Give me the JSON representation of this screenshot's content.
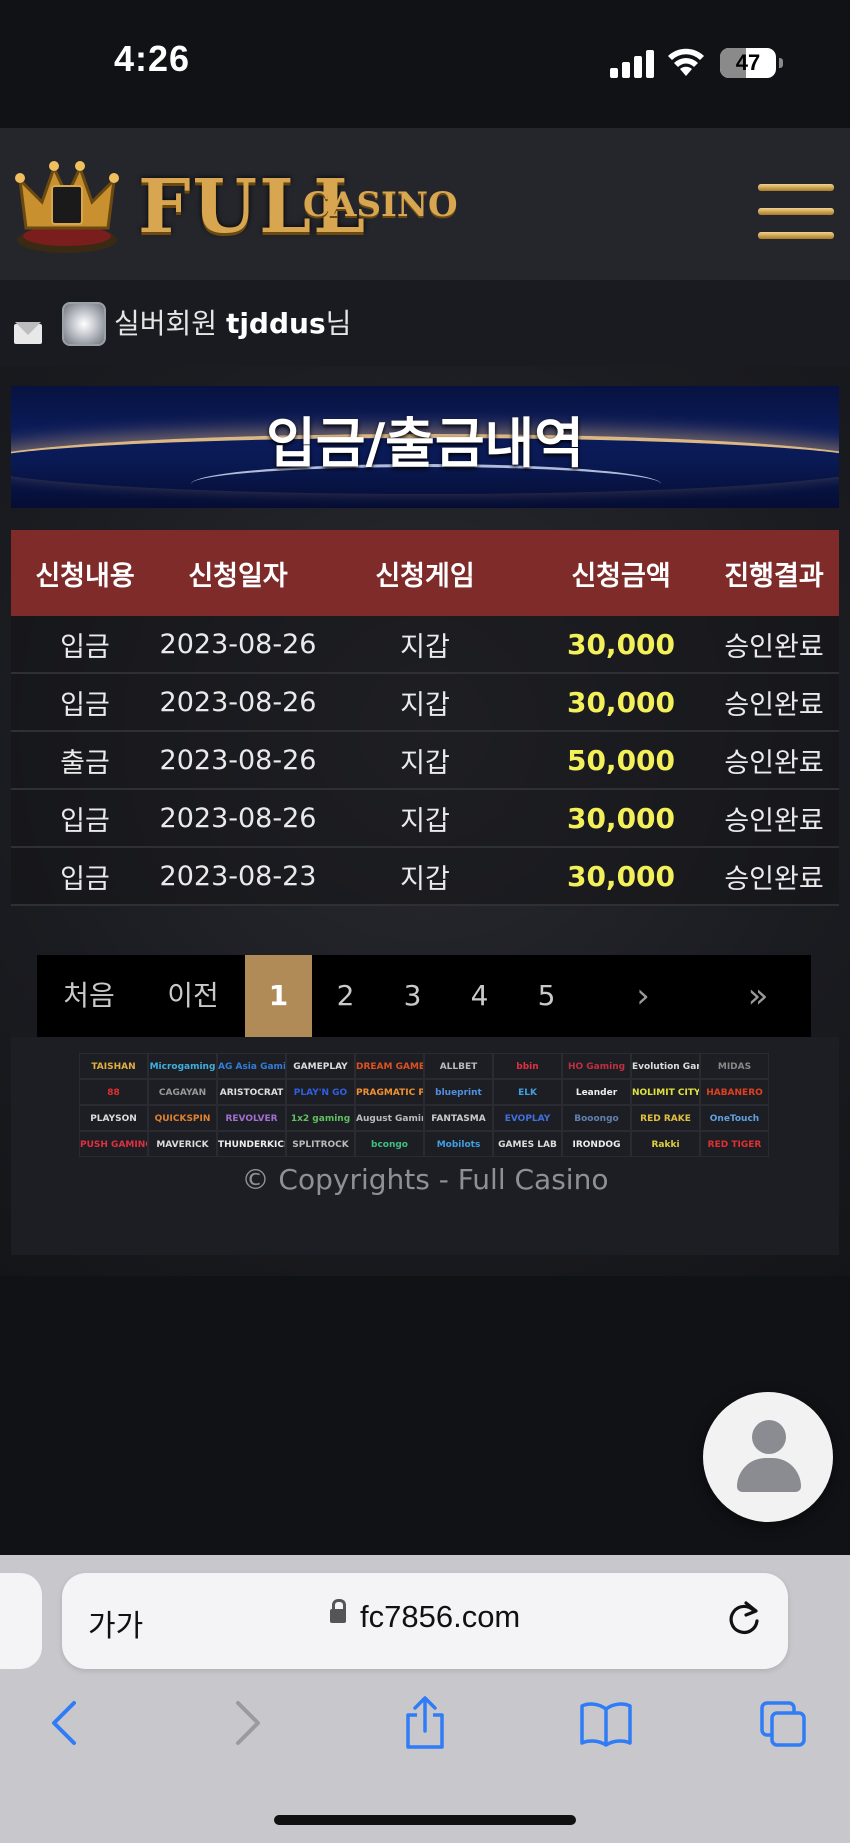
{
  "status_bar": {
    "time": "4:26",
    "battery": "47",
    "battery_level": 0.47
  },
  "header": {
    "logo_main": "FULL",
    "logo_sub": "CASINO",
    "menu_icon": "hamburger-icon"
  },
  "user": {
    "mail_icon": "mail-icon",
    "rank_icon": "silver-rank-icon",
    "grade": "실버회원",
    "username": "tjddus",
    "suffix": "님"
  },
  "page": {
    "title": "입금/출금내역"
  },
  "table": {
    "headers": [
      "신청내용",
      "신청일자",
      "신청게임",
      "신청금액",
      "진행결과"
    ],
    "rows": [
      {
        "type": "입금",
        "date": "2023-08-26",
        "game": "지갑",
        "amount": "30,000",
        "result": "승인완료"
      },
      {
        "type": "입금",
        "date": "2023-08-26",
        "game": "지갑",
        "amount": "30,000",
        "result": "승인완료"
      },
      {
        "type": "출금",
        "date": "2023-08-26",
        "game": "지갑",
        "amount": "50,000",
        "result": "승인완료"
      },
      {
        "type": "입금",
        "date": "2023-08-26",
        "game": "지갑",
        "amount": "30,000",
        "result": "승인완료"
      },
      {
        "type": "입금",
        "date": "2023-08-23",
        "game": "지갑",
        "amount": "30,000",
        "result": "승인완료"
      }
    ]
  },
  "pagination": {
    "first": "처음",
    "prev": "이전",
    "pages": [
      "1",
      "2",
      "3",
      "4",
      "5"
    ],
    "current": "1",
    "next": "›",
    "last": "»"
  },
  "providers": [
    {
      "name": "TAISHAN",
      "color": "#e0b040"
    },
    {
      "name": "Microgaming",
      "color": "#3fb0e0"
    },
    {
      "name": "AG Asia Gaming",
      "color": "#2f7fd8"
    },
    {
      "name": "GAMEPLAY",
      "color": "#dddddd"
    },
    {
      "name": "DREAM GAME",
      "color": "#e05020"
    },
    {
      "name": "ALLBET",
      "color": "#bbbbbb"
    },
    {
      "name": "bbin",
      "color": "#e03040"
    },
    {
      "name": "HO Gaming",
      "color": "#c03040"
    },
    {
      "name": "Evolution Gaming",
      "color": "#dddddd"
    },
    {
      "name": "MIDAS",
      "color": "#888888"
    },
    {
      "name": "88",
      "color": "#e03030"
    },
    {
      "name": "CAGAYAN",
      "color": "#999999"
    },
    {
      "name": "ARISTOCRAT",
      "color": "#dddddd"
    },
    {
      "name": "PLAY'N GO",
      "color": "#3060e0"
    },
    {
      "name": "PRAGMATIC PLAY",
      "color": "#f09030"
    },
    {
      "name": "blueprint",
      "color": "#5090e0"
    },
    {
      "name": "ELK",
      "color": "#40a0e0"
    },
    {
      "name": "Leander",
      "color": "#eeeeee"
    },
    {
      "name": "NOLIMIT CITY",
      "color": "#e0e040"
    },
    {
      "name": "HABANERO",
      "color": "#e04020"
    },
    {
      "name": "PLAYSON",
      "color": "#dddddd"
    },
    {
      "name": "QUICKSPIN",
      "color": "#e08030"
    },
    {
      "name": "REVOLVER",
      "color": "#a070d0"
    },
    {
      "name": "1x2 gaming",
      "color": "#60c060"
    },
    {
      "name": "August Gaming",
      "color": "#bbbbbb"
    },
    {
      "name": "FANTASMA",
      "color": "#cccccc"
    },
    {
      "name": "EVOPLAY",
      "color": "#4070e0"
    },
    {
      "name": "Booongo",
      "color": "#6080b0"
    },
    {
      "name": "RED RAKE",
      "color": "#e0c040"
    },
    {
      "name": "OneTouch",
      "color": "#60a0e0"
    },
    {
      "name": "PUSH GAMING",
      "color": "#e03040"
    },
    {
      "name": "MAVERICK",
      "color": "#dddddd"
    },
    {
      "name": "THUNDERKICK",
      "color": "#eeeeee"
    },
    {
      "name": "SPLITROCK",
      "color": "#bbbbbb"
    },
    {
      "name": "bcongo",
      "color": "#40c080"
    },
    {
      "name": "Mobilots",
      "color": "#40a0e0"
    },
    {
      "name": "GAMES LAB",
      "color": "#dddddd"
    },
    {
      "name": "IRONDOG",
      "color": "#eeeeee"
    },
    {
      "name": "Rakki",
      "color": "#e0d040"
    },
    {
      "name": "RED TIGER",
      "color": "#e03030"
    }
  ],
  "footer": {
    "copyright": "© Copyrights - Full Casino"
  },
  "chat": {
    "icon": "person-icon"
  },
  "browser": {
    "text_size": "가가",
    "url": "fc7856.com",
    "lock_icon": "lock-icon",
    "reload_icon": "reload-icon",
    "nav": [
      "back-icon",
      "forward-icon",
      "share-icon",
      "bookmarks-icon",
      "tabs-icon"
    ]
  }
}
